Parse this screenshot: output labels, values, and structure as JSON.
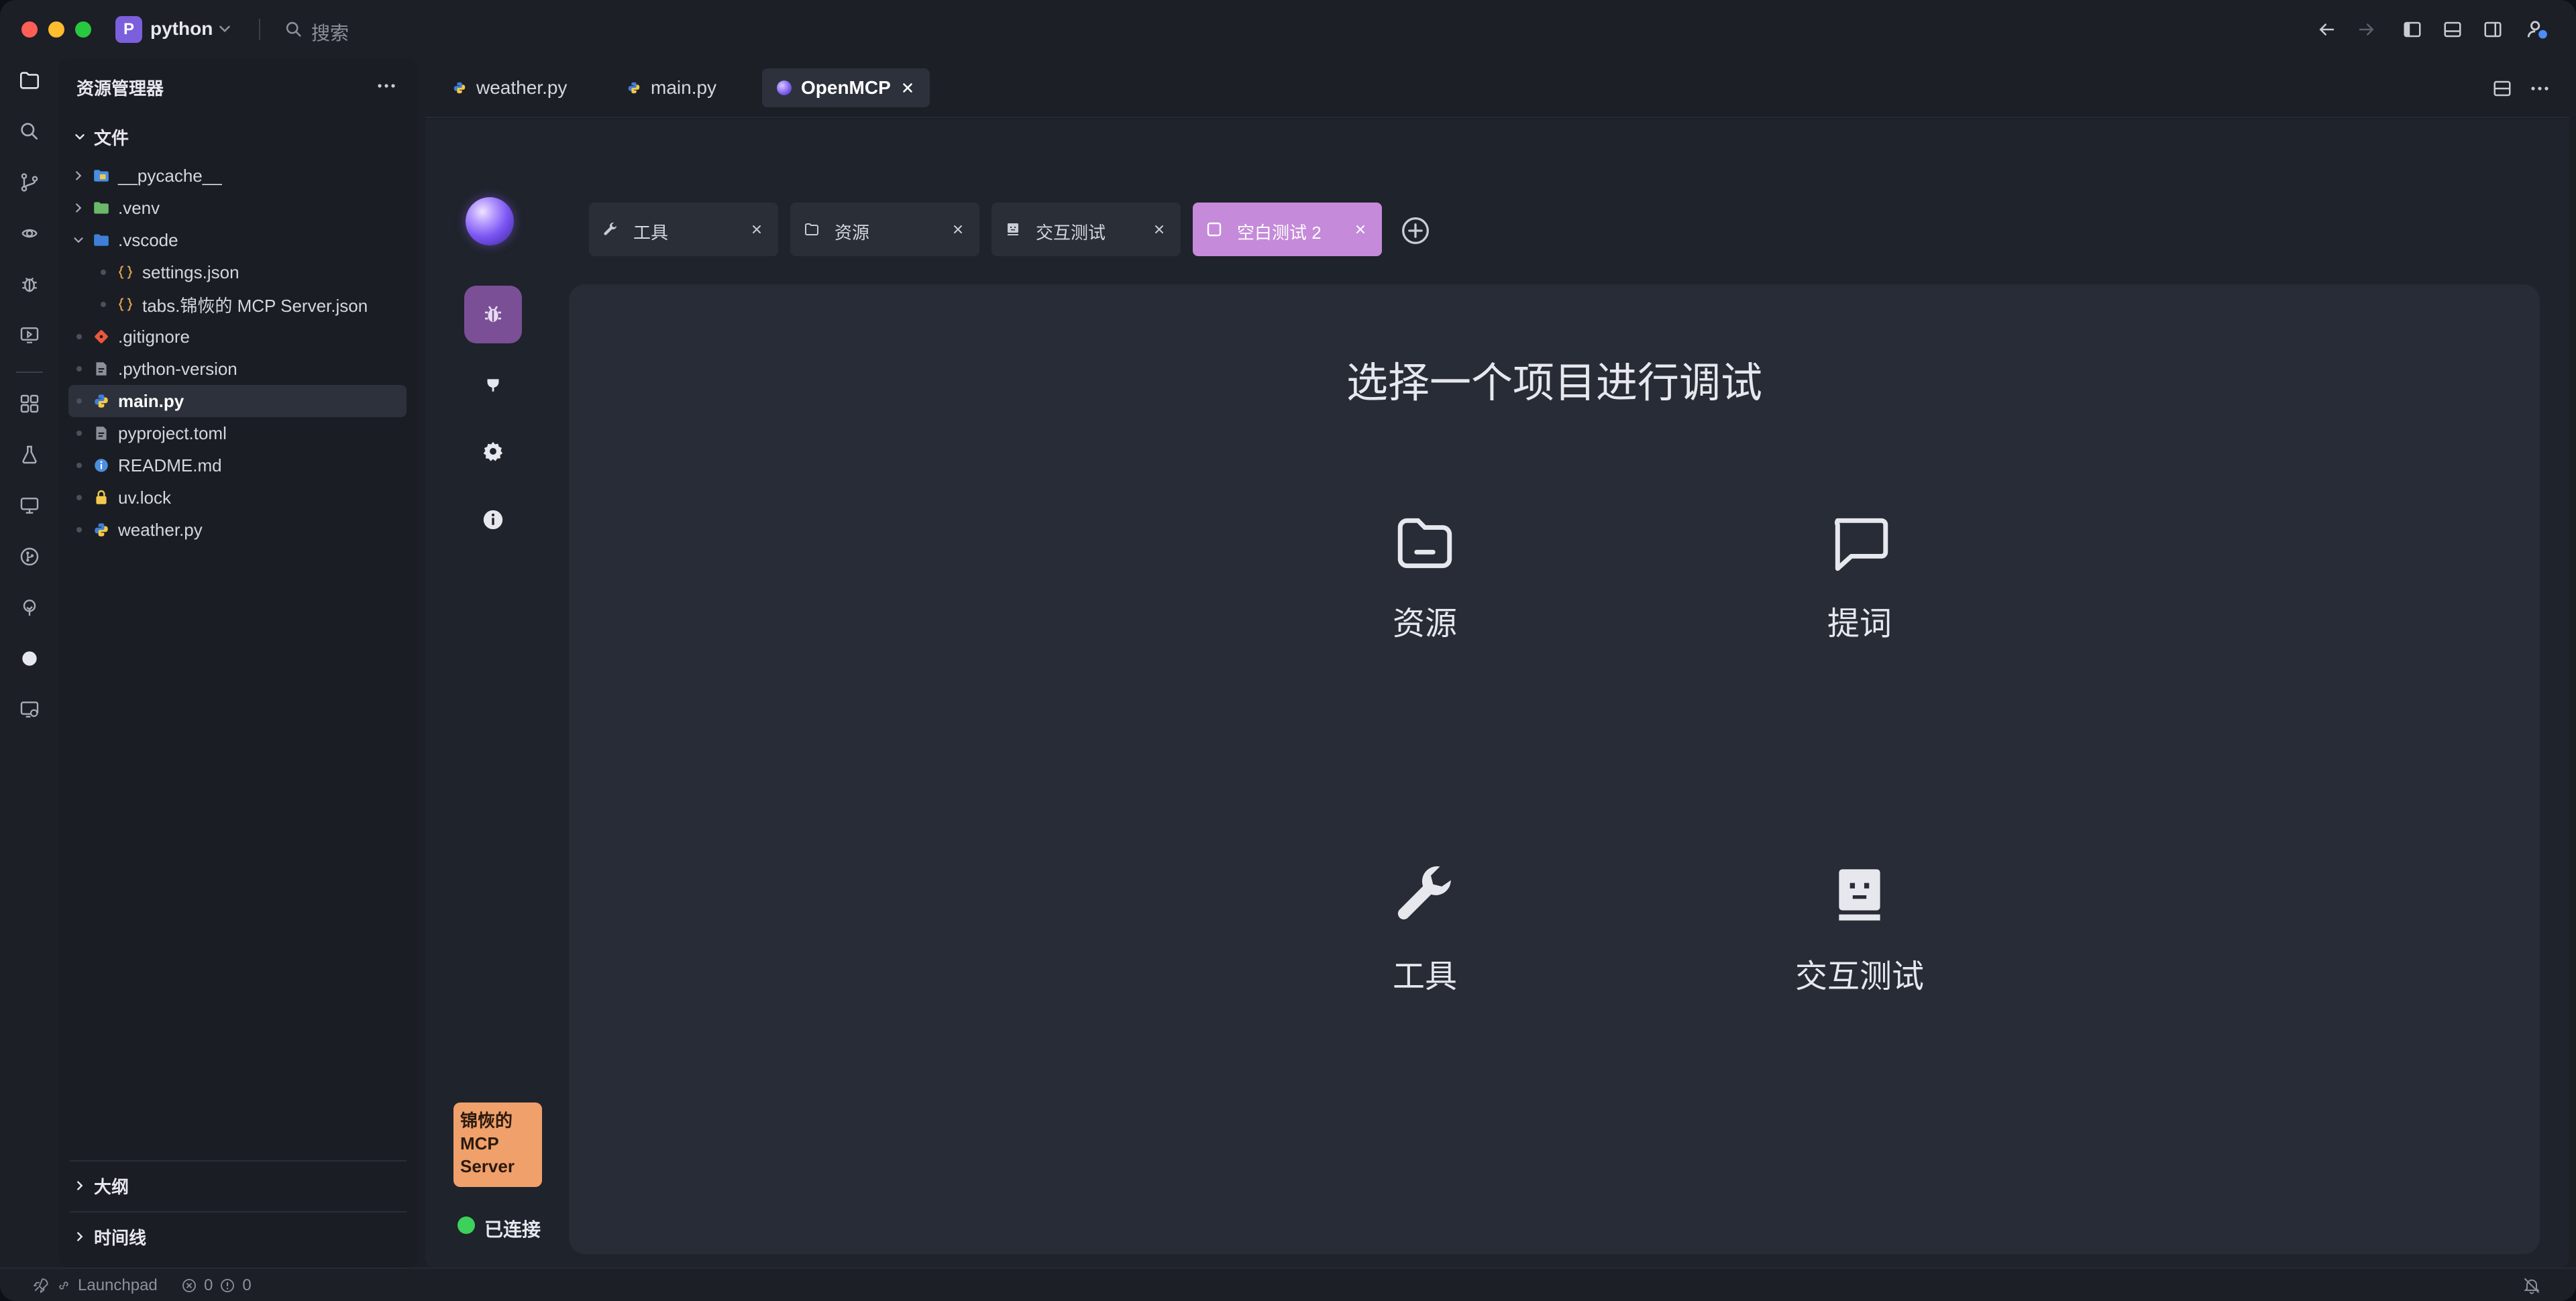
{
  "titlebar": {
    "project_badge": "P",
    "project_name": "python",
    "search_placeholder": "搜索"
  },
  "sidebar": {
    "title": "资源管理器",
    "files_section": "文件",
    "tree": [
      {
        "label": "__pycache__",
        "type": "folder",
        "expanded": false,
        "depth": 0
      },
      {
        "label": ".venv",
        "type": "folder",
        "expanded": false,
        "depth": 0
      },
      {
        "label": ".vscode",
        "type": "folder",
        "expanded": true,
        "depth": 0
      },
      {
        "label": "settings.json",
        "type": "json",
        "depth": 1
      },
      {
        "label": "tabs.锦恢的 MCP Server.json",
        "type": "json",
        "depth": 1
      },
      {
        "label": ".gitignore",
        "type": "git",
        "depth": 0
      },
      {
        "label": ".python-version",
        "type": "text",
        "depth": 0
      },
      {
        "label": "main.py",
        "type": "python",
        "depth": 0,
        "active": true
      },
      {
        "label": "pyproject.toml",
        "type": "toml",
        "depth": 0
      },
      {
        "label": "README.md",
        "type": "info",
        "depth": 0
      },
      {
        "label": "uv.lock",
        "type": "lock",
        "depth": 0
      },
      {
        "label": "weather.py",
        "type": "python",
        "depth": 0
      }
    ],
    "outline_section": "大纲",
    "timeline_section": "时间线"
  },
  "editor_tabs": [
    {
      "label": "weather.py",
      "icon": "python-icon"
    },
    {
      "label": "main.py",
      "icon": "python-icon"
    },
    {
      "label": "OpenMCP",
      "icon": "openmcp-icon",
      "active": true
    }
  ],
  "openmcp": {
    "inner_tabs": [
      {
        "label": "工具",
        "icon": "wrench-icon"
      },
      {
        "label": "资源",
        "icon": "folder-icon"
      },
      {
        "label": "交互测试",
        "icon": "robot-icon"
      },
      {
        "label": "空白测试 2",
        "icon": "square-icon",
        "active": true
      }
    ],
    "card_title": "选择一个项目进行调试",
    "choices": [
      {
        "label": "资源",
        "icon": "folder-icon"
      },
      {
        "label": "提词",
        "icon": "chat-icon"
      },
      {
        "label": "工具",
        "icon": "wrench-icon"
      },
      {
        "label": "交互测试",
        "icon": "robot-icon"
      }
    ],
    "server_name": "锦恢的 MCP Server",
    "connection_status": "已连接"
  },
  "statusbar": {
    "launchpad": "Launchpad",
    "errors": "0",
    "warnings": "0"
  },
  "colors": {
    "accent_purple": "#7a4f96",
    "active_tab_pink": "#c58ad9",
    "server_orange": "#f0a06a",
    "connected_green": "#3bd15a"
  }
}
